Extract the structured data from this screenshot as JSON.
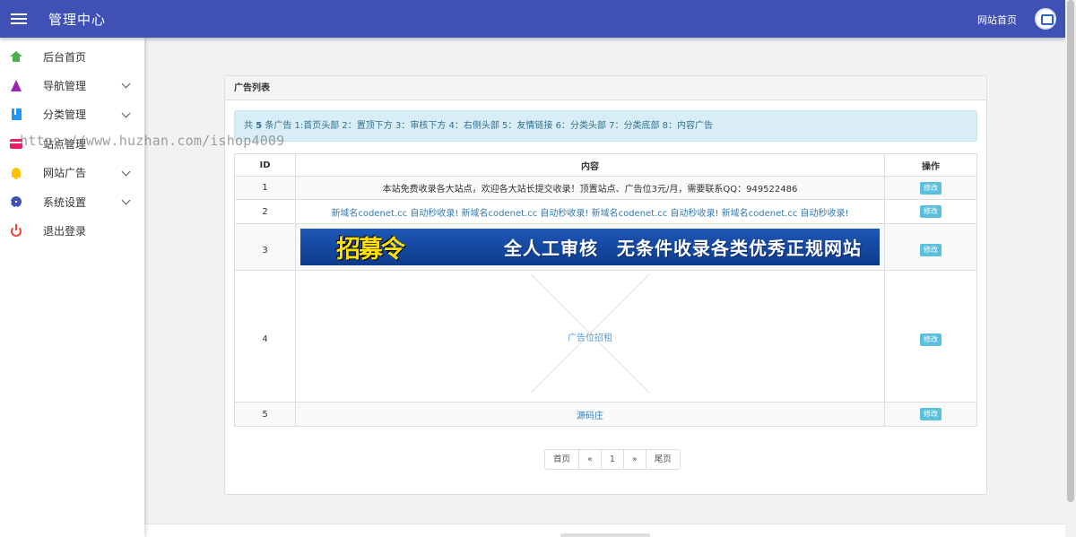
{
  "header": {
    "app_title": "管理中心",
    "home_link": "网站首页"
  },
  "sidebar": {
    "items": [
      {
        "label": "后台首页",
        "icon": "home-icon",
        "color": "#4caf50"
      },
      {
        "label": "导航管理",
        "icon": "navigation-icon",
        "color": "#9c27b0"
      },
      {
        "label": "分类管理",
        "icon": "book-icon",
        "color": "#2196f3"
      },
      {
        "label": "站点管理",
        "icon": "card-icon",
        "color": "#e91e63"
      },
      {
        "label": "网站广告",
        "icon": "bell-icon",
        "color": "#ffc107"
      },
      {
        "label": "系统设置",
        "icon": "gear-icon",
        "color": "#3f51b5"
      },
      {
        "label": "退出登录",
        "icon": "power-icon",
        "color": "#f44336"
      }
    ]
  },
  "watermark": "https://www.huzhan.com/ishop4009",
  "panel": {
    "title": "广告列表",
    "alert_prefix": "共",
    "alert_count": "5",
    "alert_text": "条广告 1:首页头部 2：置顶下方 3：审核下方 4：右侧头部 5：友情链接 6：分类头部 7：分类底部 8：内容广告"
  },
  "table": {
    "headers": [
      "ID",
      "内容",
      "操作"
    ],
    "edit_label": "修改",
    "rows": [
      {
        "id": "1",
        "content": "本站免费收录各大站点，欢迎各大站长提交收录！顶置站点、广告位3元/月，需要联系QQ：949522486"
      },
      {
        "id": "2",
        "content": "新域名codenet.cc 自动秒收录! 新域名codenet.cc 自动秒收录! 新域名codenet.cc 自动秒收录! 新域名codenet.cc 自动秒收录!"
      },
      {
        "id": "3",
        "banner_left": "招募令",
        "banner_right": "全人工审核　无条件收录各类优秀正规网站"
      },
      {
        "id": "4",
        "placeholder": "广告位招租"
      },
      {
        "id": "5",
        "content": "源码庄"
      }
    ]
  },
  "pagination": [
    "首页",
    "«",
    "1",
    "»",
    "尾页"
  ],
  "colors": {
    "header_bg": "#3f51b5",
    "edit_button": "#5bc0de",
    "alert_bg": "#d9edf7",
    "link": "#337ab7"
  }
}
